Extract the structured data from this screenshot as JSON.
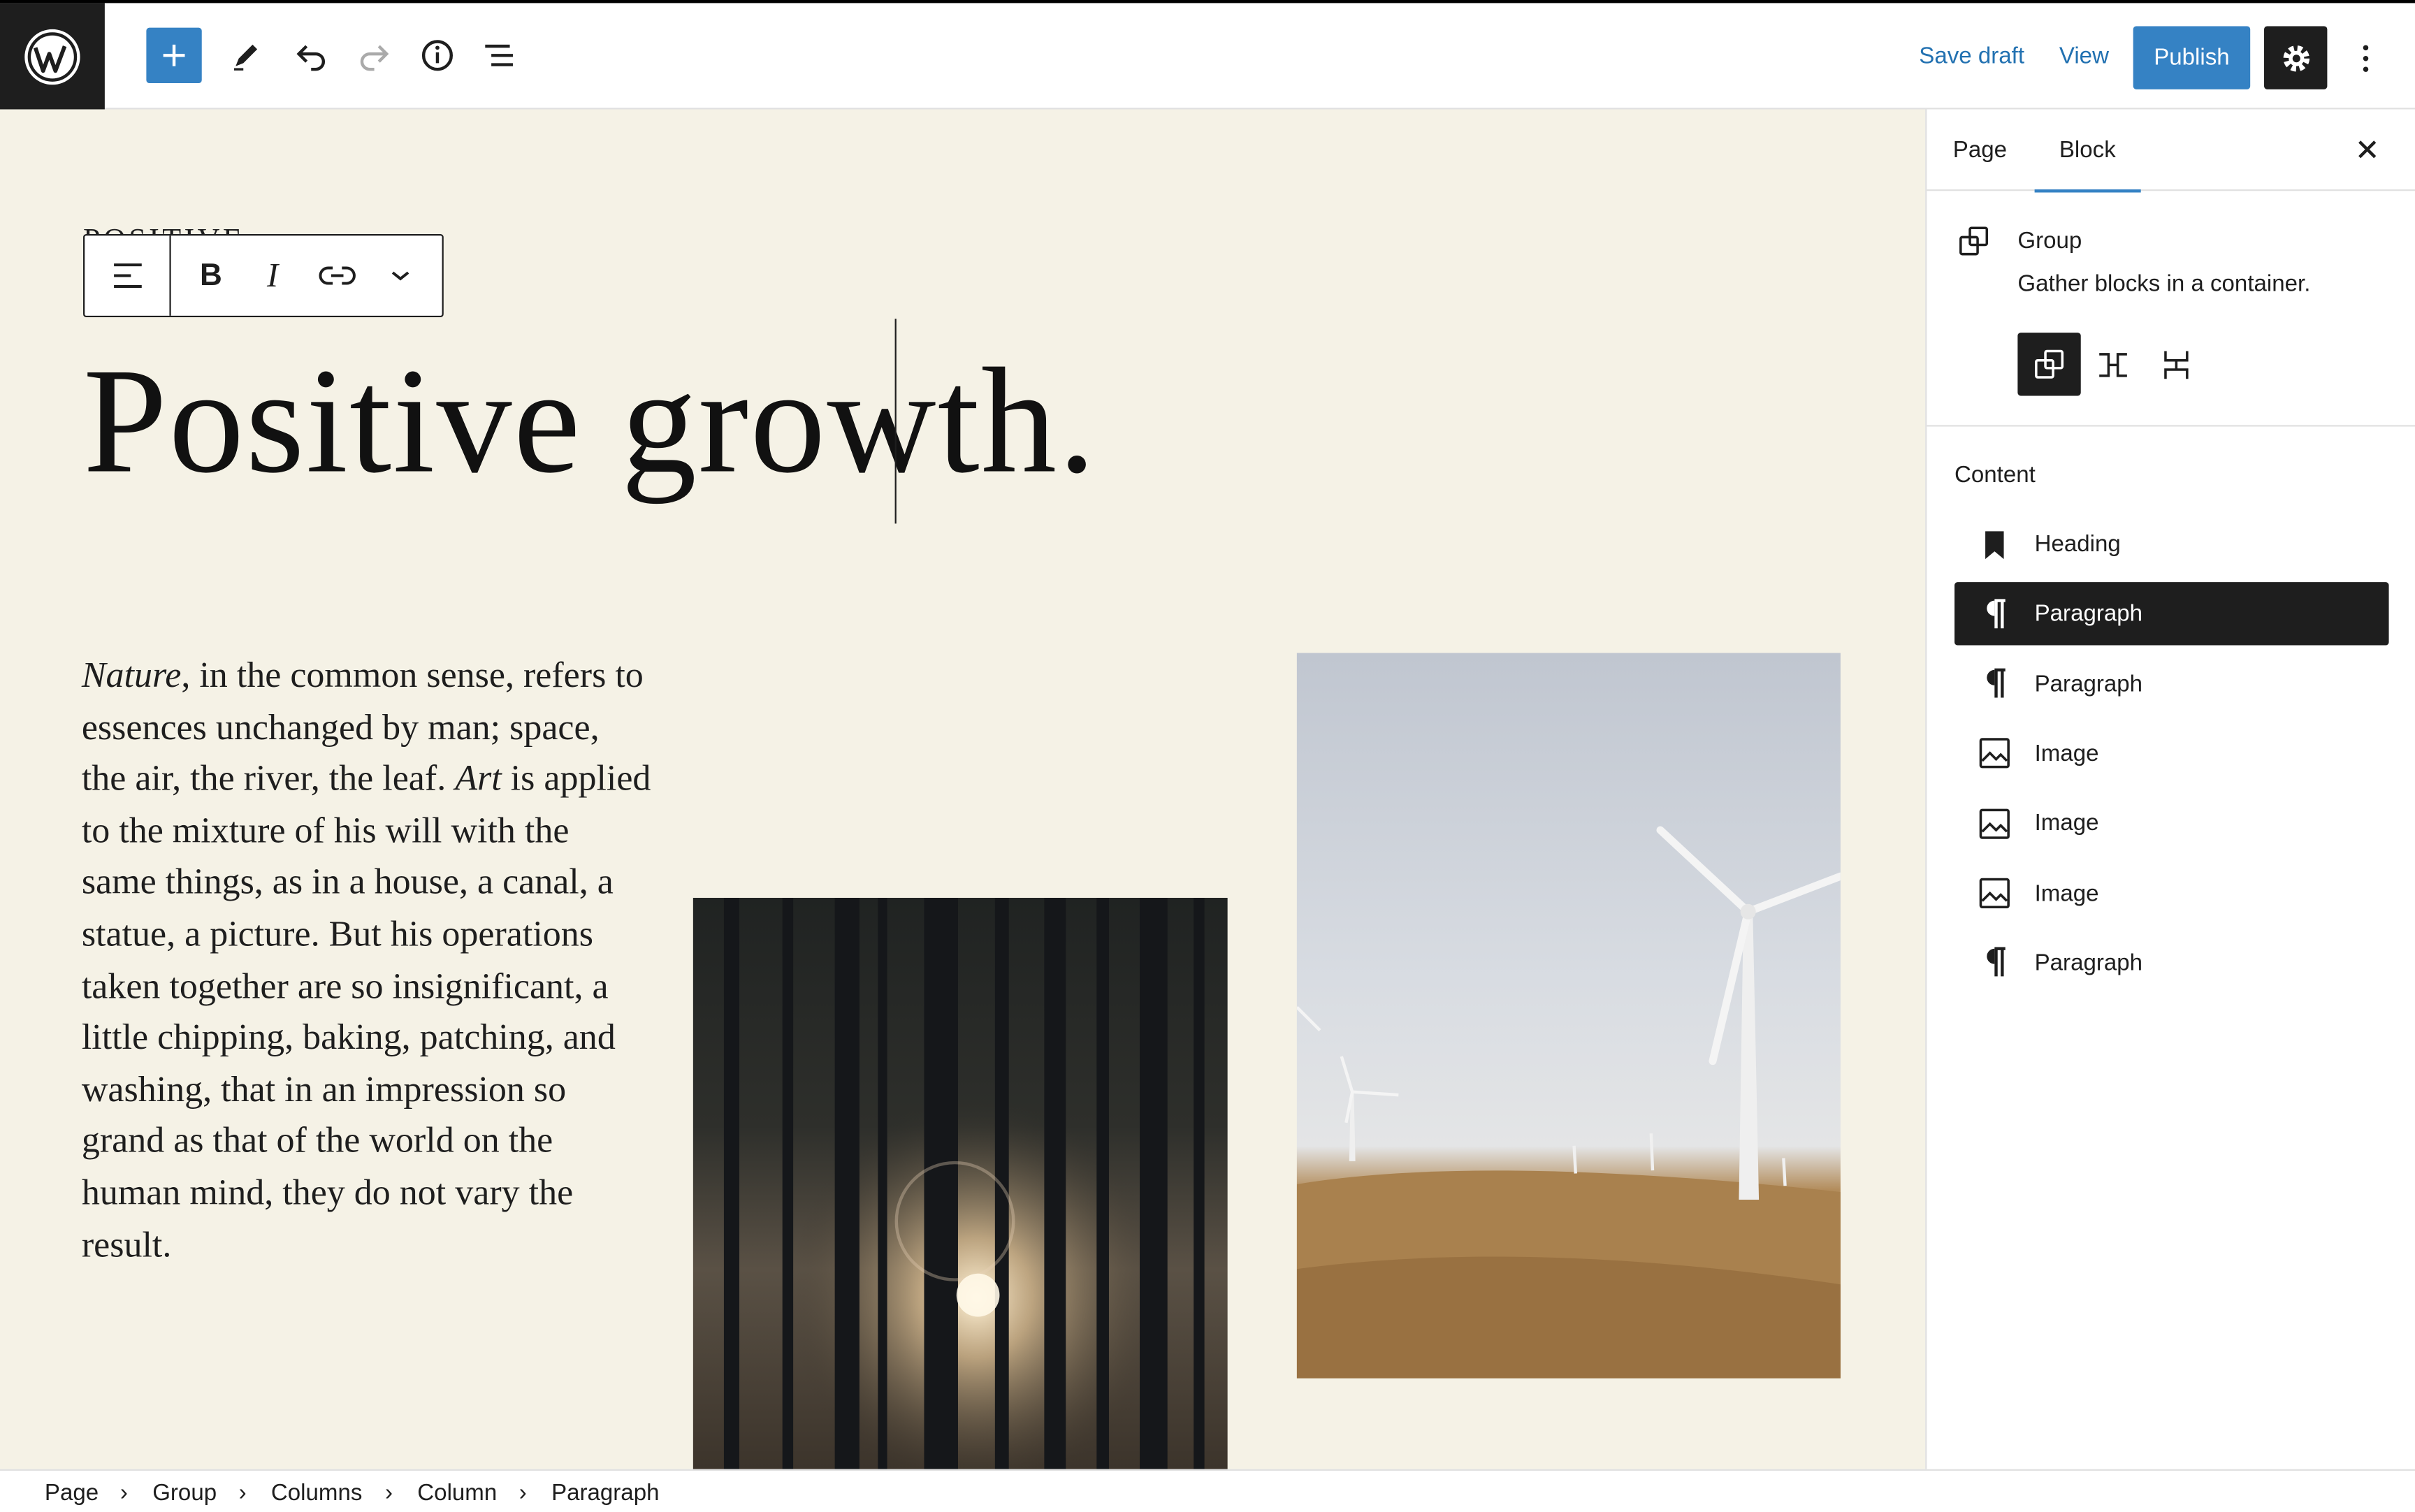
{
  "toolbar": {
    "save_draft": "Save draft",
    "view": "View",
    "publish": "Publish"
  },
  "canvas": {
    "hidden_label": "POSITIVE",
    "heading": "Positive growth.",
    "paragraph_em1": "Nature",
    "paragraph_part1": ", in the common sense, refers to essences unchanged by man; space, the air, the river, the leaf. ",
    "paragraph_em2": "Art",
    "paragraph_part2": " is applied to the mixture of his will with the same things, as in a house, a canal, a statue, a picture. But his operations taken together are so insignificant, a little chipping, baking, patching, and washing, that in an impression so grand as that of the world on the human mind, they do not vary the result."
  },
  "sidebar": {
    "tabs": [
      "Page",
      "Block"
    ],
    "active_tab": "Block",
    "block": {
      "title": "Group",
      "description": "Gather blocks in a container."
    },
    "content_title": "Content",
    "content_items": [
      {
        "label": "Heading",
        "icon": "bookmark-icon",
        "selected": false
      },
      {
        "label": "Paragraph",
        "icon": "pilcrow-icon",
        "selected": true
      },
      {
        "label": "Paragraph",
        "icon": "pilcrow-icon",
        "selected": false
      },
      {
        "label": "Image",
        "icon": "image-icon",
        "selected": false
      },
      {
        "label": "Image",
        "icon": "image-icon",
        "selected": false
      },
      {
        "label": "Image",
        "icon": "image-icon",
        "selected": false
      },
      {
        "label": "Paragraph",
        "icon": "pilcrow-icon",
        "selected": false
      }
    ]
  },
  "breadcrumb": [
    "Page",
    "Group",
    "Columns",
    "Column",
    "Paragraph"
  ],
  "colors": {
    "accent": "#3582c4",
    "dark": "#1e1e1e",
    "canvas_bg": "#f5f2e6"
  }
}
